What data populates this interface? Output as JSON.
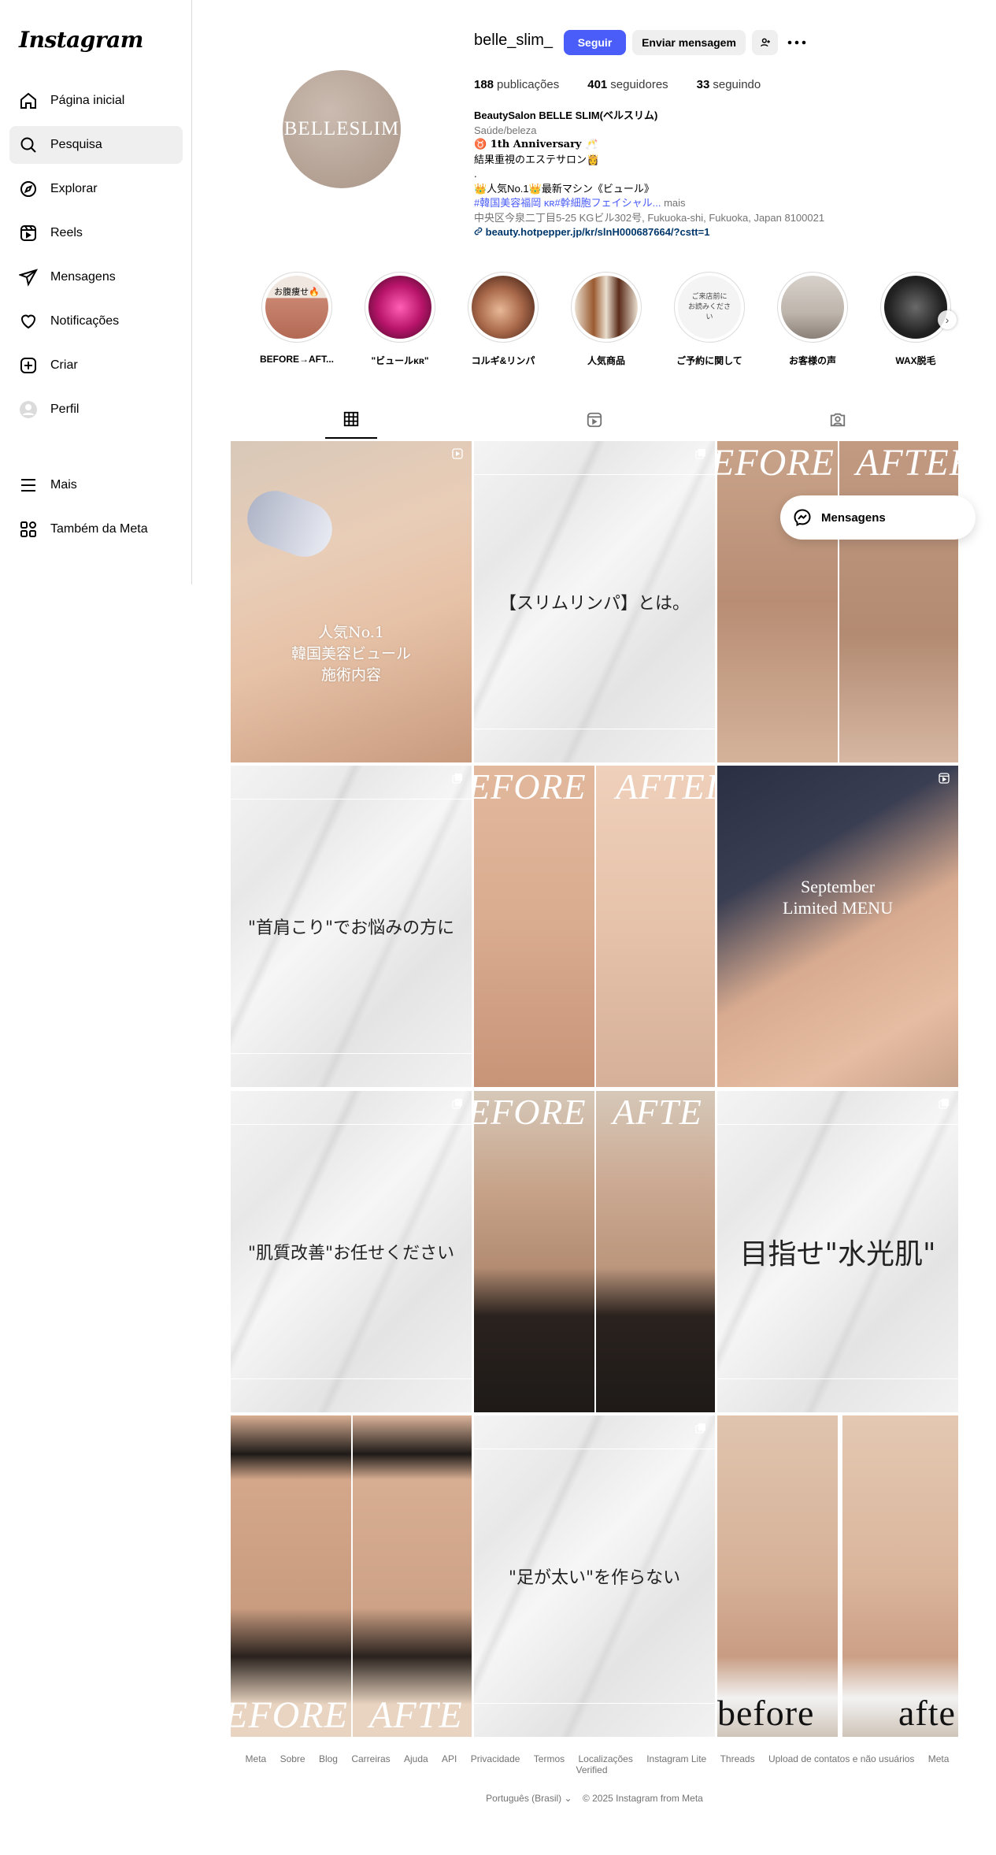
{
  "sidebar": {
    "logo": "Instagram",
    "items": [
      {
        "label": "Página inicial",
        "icon": "home-icon"
      },
      {
        "label": "Pesquisa",
        "icon": "search-icon"
      },
      {
        "label": "Explorar",
        "icon": "compass-icon"
      },
      {
        "label": "Reels",
        "icon": "reels-icon"
      },
      {
        "label": "Mensagens",
        "icon": "send-icon"
      },
      {
        "label": "Notificações",
        "icon": "heart-icon"
      },
      {
        "label": "Criar",
        "icon": "plus-square-icon"
      },
      {
        "label": "Perfil",
        "icon": "profile-icon"
      }
    ],
    "bottom": [
      {
        "label": "Mais",
        "icon": "menu-icon"
      },
      {
        "label": "Também da Meta",
        "icon": "meta-apps-icon"
      }
    ]
  },
  "profile": {
    "avatar_text": "BELLESLIM",
    "username": "belle_slim_",
    "follow_label": "Seguir",
    "message_label": "Enviar mensagem",
    "stats": {
      "posts_n": "188",
      "posts_label": "publicações",
      "followers_n": "401",
      "followers_label": "seguidores",
      "following_n": "33",
      "following_label": "seguindo"
    },
    "bio": {
      "name": "BeautySalon BELLE SLIM(ベルスリム)",
      "category": "Saúde/beleza",
      "line1": "♉ 1th Anniversary 🥂",
      "line2": "結果重視のエステサロン👸",
      "line3": ".",
      "line4": "👑人気No.1👑最新マシン《ビュール》",
      "hashtags": "#韓国美容福岡 ᴋʀ#幹細胞フェイシャル...",
      "more": " mais",
      "address": "中央区今泉二丁目5-25 KGビル302号, Fukuoka-shi, Fukuoka, Japan 8100021",
      "link": "beauty.hotpepper.jp/kr/slnH000687664/?cstt=1"
    }
  },
  "highlights": [
    {
      "label": "BEFORE→AFT...",
      "inner": "お腹痩せ🔥"
    },
    {
      "label": "\"ビュールᴋʀ\"",
      "inner": ""
    },
    {
      "label": "コルギ&リンパ",
      "inner": ""
    },
    {
      "label": "人気商品",
      "inner": ""
    },
    {
      "label": "ご予約に関して",
      "inner": "ご来店前に お読みください"
    },
    {
      "label": "お客様の声",
      "inner": ""
    },
    {
      "label": "WAX脱毛",
      "inner": ""
    }
  ],
  "posts": {
    "p1": "人気No.1\n韓国美容ビュール\n施術内容",
    "p1a": "人気No.1",
    "p1b": "韓国美容ビュール",
    "p1c": "施術内容",
    "p2": "【スリムリンパ】とは。",
    "p3a": "EFORE",
    "p3b": "AFTER",
    "p4": "\"首肩こり\"でお悩みの方に",
    "p5a": "EFORE",
    "p5b": "AFTEI",
    "p6a": "September",
    "p6b": "Limited MENU",
    "p7": "\"肌質改善\"お任せください",
    "p8a": "EFORE",
    "p8b": "AFTE",
    "p9": "目指せ\"水光肌\"",
    "p10a": "EFORE",
    "p10b": "AFTE",
    "p11": "\"足が太い\"を作らない",
    "p12a": "before",
    "p12b": "afte"
  },
  "floating": {
    "label": "Mensagens"
  },
  "footer": {
    "links": [
      "Meta",
      "Sobre",
      "Blog",
      "Carreiras",
      "Ajuda",
      "API",
      "Privacidade",
      "Termos",
      "Localizações",
      "Instagram Lite",
      "Threads",
      "Upload de contatos e não usuários",
      "Meta Verified"
    ],
    "language": "Português (Brasil)",
    "copyright": "© 2025 Instagram from Meta"
  },
  "colors": {
    "accent": "#4a5df9",
    "link": "#00376b",
    "muted": "#737373"
  }
}
